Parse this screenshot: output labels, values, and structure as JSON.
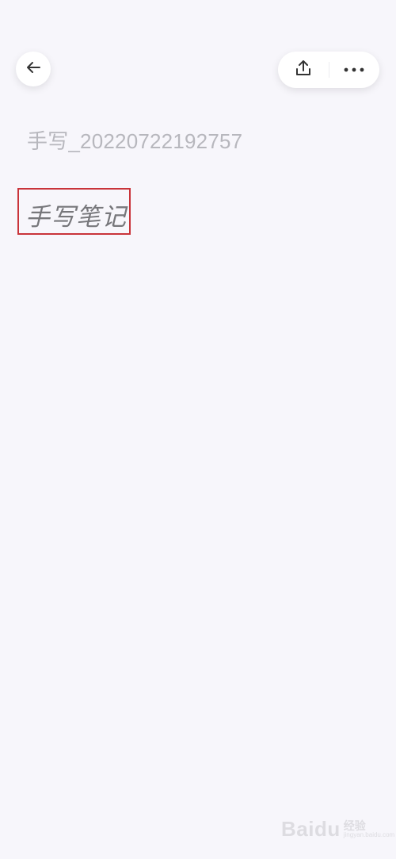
{
  "toolbar": {
    "back_icon": "arrow-left-icon",
    "share_icon": "share-upload-icon",
    "more_icon": "more-horizontal-icon"
  },
  "note": {
    "title": "手写_20220722192757",
    "handwritten_text": "手写笔记"
  },
  "highlight": {
    "border_color": "#c9343a"
  },
  "watermark": {
    "logo": "Bai",
    "logo_suffix": "du",
    "cn": "经验",
    "url": "jingyan.baidu.com"
  },
  "colors": {
    "background": "#f7f6fb",
    "title_text": "#b7b7bd",
    "handwriting": "#77777b"
  }
}
